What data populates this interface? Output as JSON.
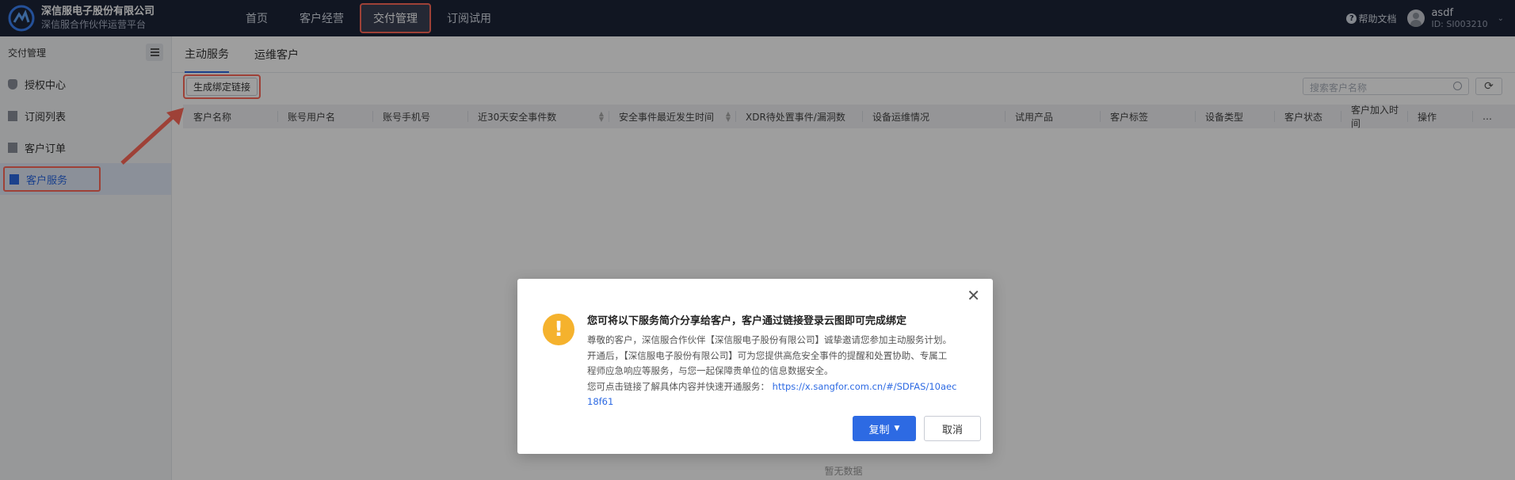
{
  "app": {
    "company_name": "深信服电子股份有限公司",
    "platform_name": "深信服合作伙伴运营平台"
  },
  "nav": {
    "items": [
      {
        "label": "首页"
      },
      {
        "label": "客户经营"
      },
      {
        "label": "交付管理"
      },
      {
        "label": "订阅试用"
      }
    ],
    "active": "交付管理"
  },
  "header_right": {
    "help_label": "帮助文档",
    "user_name": "asdf",
    "user_id": "ID: SI003210"
  },
  "sidebar": {
    "title": "交付管理",
    "items": [
      {
        "label": "授权中心"
      },
      {
        "label": "订阅列表"
      },
      {
        "label": "客户订单"
      },
      {
        "label": "客户服务"
      }
    ],
    "active": "客户服务"
  },
  "main": {
    "tabs": [
      {
        "label": "主动服务"
      },
      {
        "label": "运维客户"
      }
    ],
    "active_tab": "主动服务",
    "generate_button": "生成绑定链接",
    "search_placeholder": "搜索客户名称",
    "columns": [
      "客户名称",
      "账号用户名",
      "账号手机号",
      "近30天安全事件数",
      "安全事件最近发生时间",
      "XDR待处置事件/漏洞数",
      "设备运维情况",
      "试用产品",
      "客户标签",
      "设备类型",
      "客户状态",
      "客户加入时间",
      "操作"
    ],
    "more": "…",
    "empty_text": "暂无数据"
  },
  "dialog": {
    "title": "您可将以下服务简介分享给客户，客户通过链接登录云图即可完成绑定",
    "line1": "尊敬的客户，深信服合作伙伴【深信服电子股份有限公司】诚挚邀请您参加主动服务计划。",
    "line2": "开通后，【深信服电子股份有限公司】可为您提供高危安全事件的提醒和处置协助、专属工",
    "line3": "程师应急响应等服务，与您一起保障贵单位的信息数据安全。",
    "line4_prefix": "您可点击链接了解具体内容并快速开通服务：",
    "link_part1": "https://x.sangfor.com.cn/#/SDFAS/10aec",
    "link_part2": "18f61",
    "copy_button": "复制",
    "cancel_button": "取消"
  },
  "colors": {
    "topbar": "#1c2438",
    "accent": "#2d6ae3",
    "highlight": "#ff6a5a",
    "warning": "#f5b22d"
  }
}
